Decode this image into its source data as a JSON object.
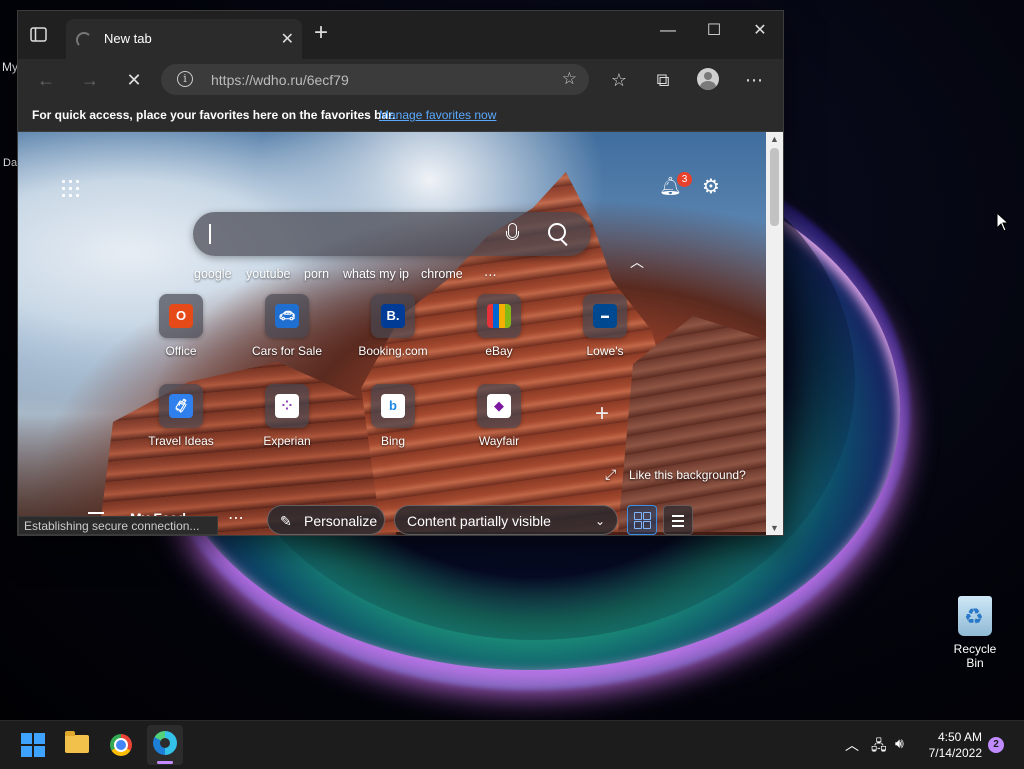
{
  "desktop": {
    "left_labels": [
      "My",
      "Da"
    ],
    "recycle_bin_label": "Recycle Bin"
  },
  "browser": {
    "tab_title": "New tab",
    "new_tab_symbol": "+",
    "url": "https://wdho.ru/6ecf79",
    "favorites_bar_message": "For quick access, place your favorites here on the favorites bar.",
    "favorites_bar_link": "Manage favorites now",
    "status_text": "Establishing secure connection..."
  },
  "newtab": {
    "notification_count": "3",
    "quick_links": [
      "google",
      "youtube",
      "porn",
      "whats my ip",
      "chrome"
    ],
    "quick_links_more": "⋯",
    "tiles_row1": [
      {
        "label": "Office",
        "icon": "office-icon",
        "color": "#e64a19"
      },
      {
        "label": "Cars for Sale",
        "icon": "cars-icon",
        "color": "#1f6fd1"
      },
      {
        "label": "Booking.com",
        "icon": "booking-icon",
        "color": "#003b95"
      },
      {
        "label": "eBay",
        "icon": "ebay-icon",
        "color": "#e53238"
      },
      {
        "label": "Lowe's",
        "icon": "lowes-icon",
        "color": "#004990"
      }
    ],
    "tiles_row2": [
      {
        "label": "Travel Ideas",
        "icon": "travel-icon",
        "color": "#2f80ed"
      },
      {
        "label": "Experian",
        "icon": "experian-icon",
        "color": "#8a3ab9"
      },
      {
        "label": "Bing",
        "icon": "bing-icon",
        "color": "#1e88e5"
      },
      {
        "label": "Wayfair",
        "icon": "wayfair-icon",
        "color": "#7b189f"
      }
    ],
    "like_background": "Like this background?",
    "my_feed": "My Feed",
    "personalize": "Personalize",
    "content_visibility": "Content partially visible"
  },
  "taskbar": {
    "time": "4:50 AM",
    "date": "7/14/2022",
    "notification_count": "2"
  }
}
